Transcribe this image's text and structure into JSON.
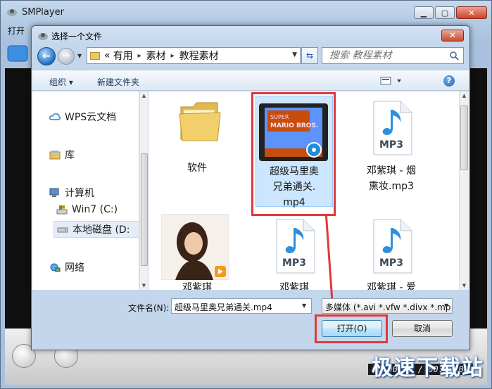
{
  "app": {
    "title": "SMPlayer",
    "menu": [
      "打开"
    ],
    "time_display": "00:00:00 / 00:00:00",
    "watermark": "极速下载站"
  },
  "dialog": {
    "title": "选择一个文件",
    "close_label": "✕",
    "address": {
      "crumbs": [
        "«",
        "有用",
        "素材",
        "教程素材"
      ],
      "separators": [
        "▸",
        "▸"
      ]
    },
    "search": {
      "placeholder": "搜索 教程素材"
    },
    "toolbar": {
      "organize_label": "组织 ▾",
      "new_folder_label": "新建文件夹"
    },
    "nav_items": [
      {
        "label": "WPS云文档",
        "icon": "cloud-icon"
      },
      {
        "label": "库",
        "icon": "library-icon"
      },
      {
        "label": "计算机",
        "icon": "computer-icon"
      },
      {
        "label": "Win7 (C:)",
        "icon": "windows-drive-icon"
      },
      {
        "label": "本地磁盘 (D:",
        "icon": "drive-icon"
      },
      {
        "label": "网络",
        "icon": "network-icon"
      }
    ],
    "files": [
      {
        "name": "软件",
        "type": "folder"
      },
      {
        "name": "超级马里奥兄弟通关.mp4",
        "type": "video",
        "thumb_text": "SUPER MARIO BROS."
      },
      {
        "name": "邓紫琪 - 烟熏妆.mp3",
        "type": "audio",
        "badge": "MP3"
      },
      {
        "name": "邓紫琪",
        "type": "image"
      },
      {
        "name": "邓紫琪",
        "type": "audio",
        "badge": "MP3"
      },
      {
        "name": "邓紫琪 - 爱",
        "type": "audio",
        "badge": "MP3"
      }
    ],
    "file_label_lines": {
      "mario": [
        "超级马里奥",
        "兄弟通关.",
        "mp4"
      ],
      "song": [
        "邓紫琪 - 烟",
        "熏妆.mp3"
      ]
    },
    "filename_label": "文件名(N):",
    "filename_value": "超级马里奥兄弟通关.mp4",
    "filter_value": "多媒体 (*.avi *.vfw *.divx *.mp",
    "open_label": "打开(O)",
    "cancel_label": "取消"
  },
  "colors": {
    "highlight": "#e0393b",
    "selected_bg": "#cde6ff",
    "accent_blue": "#1f6fc2"
  }
}
